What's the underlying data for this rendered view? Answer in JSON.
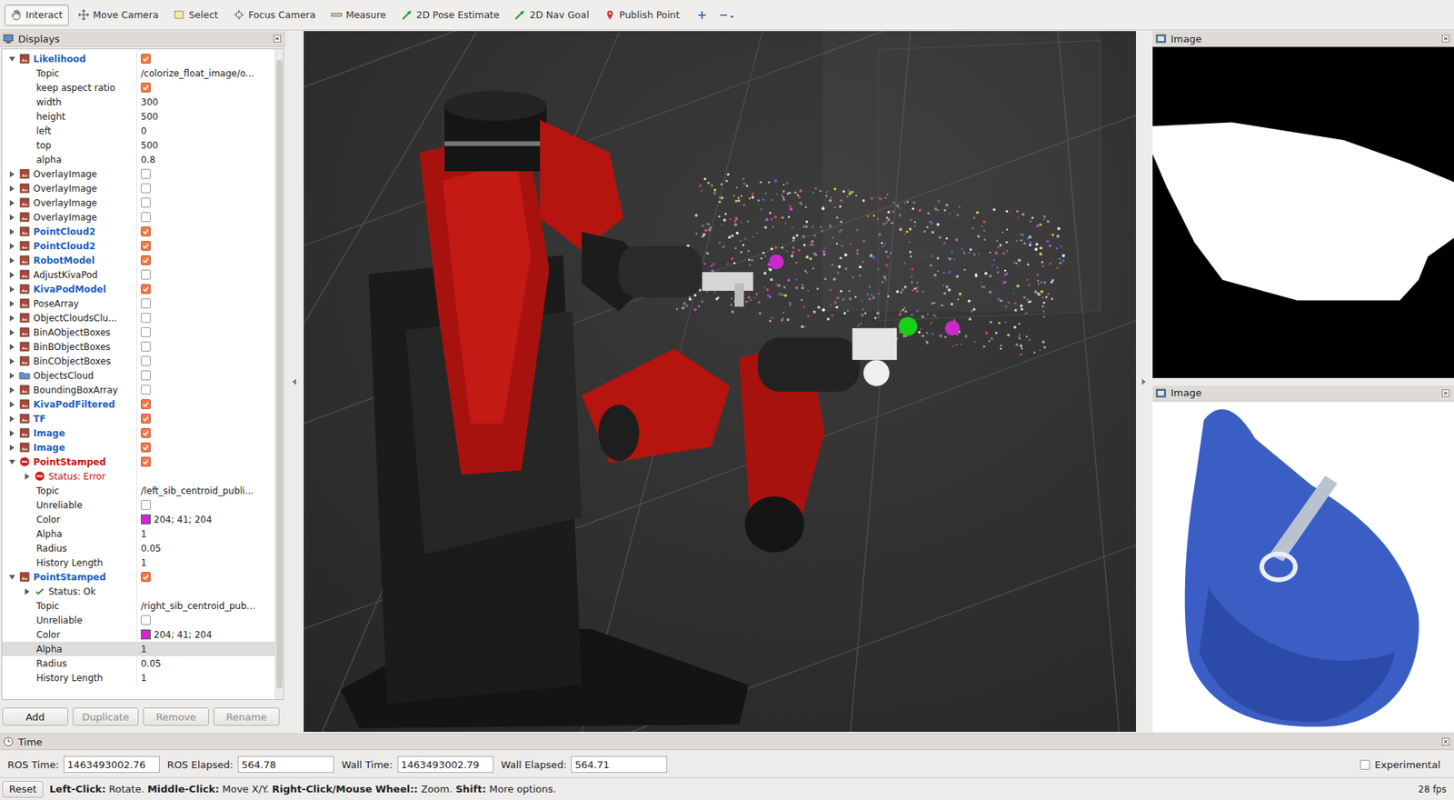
{
  "toolbar": {
    "tools": [
      {
        "label": "Interact",
        "selected": true
      },
      {
        "label": "Move Camera",
        "selected": false
      },
      {
        "label": "Select",
        "selected": false
      },
      {
        "label": "Focus Camera",
        "selected": false
      },
      {
        "label": "Measure",
        "selected": false
      },
      {
        "label": "2D Pose Estimate",
        "selected": false
      },
      {
        "label": "2D Nav Goal",
        "selected": false
      },
      {
        "label": "Publish Point",
        "selected": false
      }
    ]
  },
  "displays": {
    "title": "Displays",
    "items": [
      {
        "kind": "display",
        "label": "Likelihood",
        "depth": 0,
        "expanded": true,
        "checked": true,
        "error": false,
        "selected": false
      },
      {
        "kind": "text",
        "label": "Topic",
        "depth": 1,
        "value": "/colorize_float_image/o...",
        "selected": false
      },
      {
        "kind": "check",
        "label": "keep aspect ratio",
        "depth": 1,
        "checked": true,
        "selected": false
      },
      {
        "kind": "text",
        "label": "width",
        "depth": 1,
        "value": "300",
        "selected": false
      },
      {
        "kind": "text",
        "label": "height",
        "depth": 1,
        "value": "500",
        "selected": false
      },
      {
        "kind": "text",
        "label": "left",
        "depth": 1,
        "value": "0",
        "selected": false
      },
      {
        "kind": "text",
        "label": "top",
        "depth": 1,
        "value": "500",
        "selected": false
      },
      {
        "kind": "text",
        "label": "alpha",
        "depth": 1,
        "value": "0.8",
        "selected": false
      },
      {
        "kind": "display",
        "label": "OverlayImage",
        "depth": 0,
        "expanded": false,
        "checked": false,
        "error": false,
        "selected": false
      },
      {
        "kind": "display",
        "label": "OverlayImage",
        "depth": 0,
        "expanded": false,
        "checked": false,
        "error": false,
        "selected": false
      },
      {
        "kind": "display",
        "label": "OverlayImage",
        "depth": 0,
        "expanded": false,
        "checked": false,
        "error": false,
        "selected": false
      },
      {
        "kind": "display",
        "label": "OverlayImage",
        "depth": 0,
        "expanded": false,
        "checked": false,
        "error": false,
        "selected": false
      },
      {
        "kind": "display",
        "label": "PointCloud2",
        "depth": 0,
        "expanded": false,
        "checked": true,
        "error": false,
        "selected": false
      },
      {
        "kind": "display",
        "label": "PointCloud2",
        "depth": 0,
        "expanded": false,
        "checked": true,
        "error": false,
        "selected": false
      },
      {
        "kind": "display",
        "label": "RobotModel",
        "depth": 0,
        "expanded": false,
        "checked": true,
        "error": false,
        "selected": false
      },
      {
        "kind": "display",
        "label": "AdjustKivaPod",
        "depth": 0,
        "expanded": false,
        "checked": false,
        "error": false,
        "selected": false
      },
      {
        "kind": "display",
        "label": "KivaPodModel",
        "depth": 0,
        "expanded": false,
        "checked": true,
        "error": false,
        "selected": false
      },
      {
        "kind": "display",
        "label": "PoseArray",
        "depth": 0,
        "expanded": false,
        "checked": false,
        "error": false,
        "selected": false
      },
      {
        "kind": "display",
        "label": "ObjectCloudsClu...",
        "depth": 0,
        "expanded": false,
        "checked": false,
        "error": false,
        "selected": false
      },
      {
        "kind": "display",
        "label": "BinAObjectBoxes",
        "depth": 0,
        "expanded": false,
        "checked": false,
        "error": false,
        "selected": false
      },
      {
        "kind": "display",
        "label": "BinBObjectBoxes",
        "depth": 0,
        "expanded": false,
        "checked": false,
        "error": false,
        "selected": false
      },
      {
        "kind": "display",
        "label": "BinCObjectBoxes",
        "depth": 0,
        "expanded": false,
        "checked": false,
        "error": false,
        "selected": false
      },
      {
        "kind": "group",
        "label": "ObjectsCloud",
        "depth": 0,
        "expanded": false,
        "checked": false,
        "error": false,
        "selected": false
      },
      {
        "kind": "display",
        "label": "BoundingBoxArray",
        "depth": 0,
        "expanded": false,
        "checked": false,
        "error": false,
        "selected": false
      },
      {
        "kind": "display",
        "label": "KivaPodFiltered",
        "depth": 0,
        "expanded": false,
        "checked": true,
        "error": false,
        "selected": false
      },
      {
        "kind": "display",
        "label": "TF",
        "depth": 0,
        "expanded": false,
        "checked": true,
        "error": false,
        "selected": false
      },
      {
        "kind": "display",
        "label": "Image",
        "depth": 0,
        "expanded": false,
        "checked": true,
        "error": false,
        "selected": false
      },
      {
        "kind": "display",
        "label": "Image",
        "depth": 0,
        "expanded": false,
        "checked": true,
        "error": false,
        "selected": false
      },
      {
        "kind": "display",
        "label": "PointStamped",
        "depth": 0,
        "expanded": true,
        "checked": true,
        "error": true,
        "selected": false
      },
      {
        "kind": "status",
        "label": "Status: Error",
        "depth": 1,
        "expanded": false,
        "error": true,
        "selected": false
      },
      {
        "kind": "text",
        "label": "Topic",
        "depth": 1,
        "value": "/left_sib_centroid_publi...",
        "selected": false
      },
      {
        "kind": "check",
        "label": "Unreliable",
        "depth": 1,
        "checked": false,
        "selected": false
      },
      {
        "kind": "color",
        "label": "Color",
        "depth": 1,
        "value": "204; 41; 204",
        "color": "#cc29cc",
        "selected": false
      },
      {
        "kind": "text",
        "label": "Alpha",
        "depth": 1,
        "value": "1",
        "selected": false
      },
      {
        "kind": "text",
        "label": "Radius",
        "depth": 1,
        "value": "0.05",
        "selected": false
      },
      {
        "kind": "text",
        "label": "History Length",
        "depth": 1,
        "value": "1",
        "selected": false
      },
      {
        "kind": "display",
        "label": "PointStamped",
        "depth": 0,
        "expanded": true,
        "checked": true,
        "error": false,
        "selected": false
      },
      {
        "kind": "status",
        "label": "Status: Ok",
        "depth": 1,
        "expanded": false,
        "error": false,
        "selected": false
      },
      {
        "kind": "text",
        "label": "Topic",
        "depth": 1,
        "value": "/right_sib_centroid_pub...",
        "selected": false
      },
      {
        "kind": "check",
        "label": "Unreliable",
        "depth": 1,
        "checked": false,
        "selected": false
      },
      {
        "kind": "color",
        "label": "Color",
        "depth": 1,
        "value": "204; 41; 204",
        "color": "#cc29cc",
        "selected": false
      },
      {
        "kind": "text",
        "label": "Alpha",
        "depth": 1,
        "value": "1",
        "selected": true
      },
      {
        "kind": "text",
        "label": "Radius",
        "depth": 1,
        "value": "0.05",
        "selected": false
      },
      {
        "kind": "text",
        "label": "History Length",
        "depth": 1,
        "value": "1",
        "selected": false
      }
    ],
    "buttons": [
      {
        "label": "Add",
        "disabled": false
      },
      {
        "label": "Duplicate",
        "disabled": true
      },
      {
        "label": "Remove",
        "disabled": true
      },
      {
        "label": "Rename",
        "disabled": true
      }
    ]
  },
  "images": [
    {
      "title": "Image"
    },
    {
      "title": "Image"
    }
  ],
  "time": {
    "title": "Time",
    "fields": [
      {
        "label": "ROS Time:",
        "value": "1463493002.76"
      },
      {
        "label": "ROS Elapsed:",
        "value": "564.78"
      },
      {
        "label": "Wall Time:",
        "value": "1463493002.79"
      },
      {
        "label": "Wall Elapsed:",
        "value": "564.71"
      }
    ],
    "experimental": {
      "label": "Experimental",
      "checked": false
    }
  },
  "status_bar": {
    "reset": "Reset",
    "hint": [
      {
        "text": "Left-Click:",
        "bold": true
      },
      {
        "text": " Rotate. ",
        "bold": false
      },
      {
        "text": "Middle-Click:",
        "bold": true
      },
      {
        "text": " Move X/Y. ",
        "bold": false
      },
      {
        "text": "Right-Click/Mouse Wheel::",
        "bold": true
      },
      {
        "text": " Zoom. ",
        "bold": false
      },
      {
        "text": "Shift:",
        "bold": true
      },
      {
        "text": " More options.",
        "bold": false
      }
    ],
    "fps": "28 fps"
  }
}
